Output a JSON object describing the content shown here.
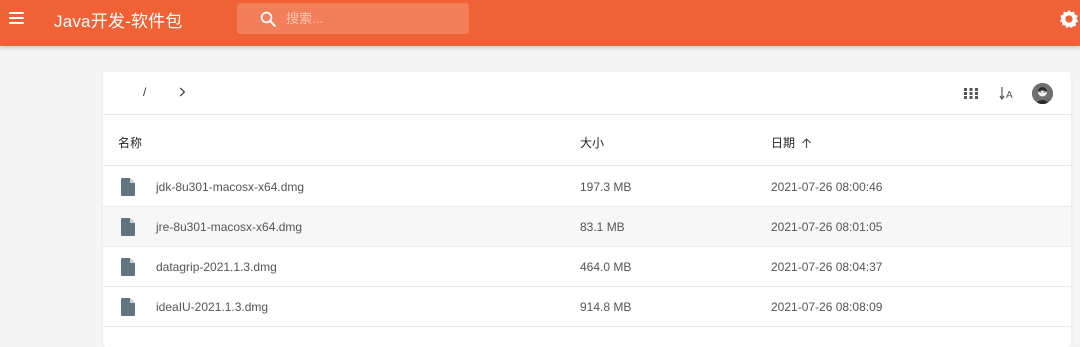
{
  "app": {
    "title": "Java开发-软件包",
    "accent_color": "#ef6236"
  },
  "search": {
    "placeholder": "搜索..."
  },
  "icons": {
    "menu": "menu-icon",
    "search": "search-icon",
    "settings": "settings-icon",
    "chevron": "chevron-right-icon",
    "grid": "grid-view-icon",
    "sort": "sort-alpha-icon",
    "file": "file-icon",
    "sort_arrow": "arrow-up-icon"
  },
  "breadcrumb": {
    "root": "/"
  },
  "table": {
    "headers": {
      "name": "名称",
      "size": "大小",
      "date": "日期"
    },
    "rows": [
      {
        "name": "jdk-8u301-macosx-x64.dmg",
        "size": "197.3 MB",
        "date": "2021-07-26 08:00:46"
      },
      {
        "name": "jre-8u301-macosx-x64.dmg",
        "size": "83.1 MB",
        "date": "2021-07-26 08:01:05"
      },
      {
        "name": "datagrip-2021.1.3.dmg",
        "size": "464.0 MB",
        "date": "2021-07-26 08:04:37"
      },
      {
        "name": "ideaIU-2021.1.3.dmg",
        "size": "914.8 MB",
        "date": "2021-07-26 08:08:09"
      }
    ]
  }
}
